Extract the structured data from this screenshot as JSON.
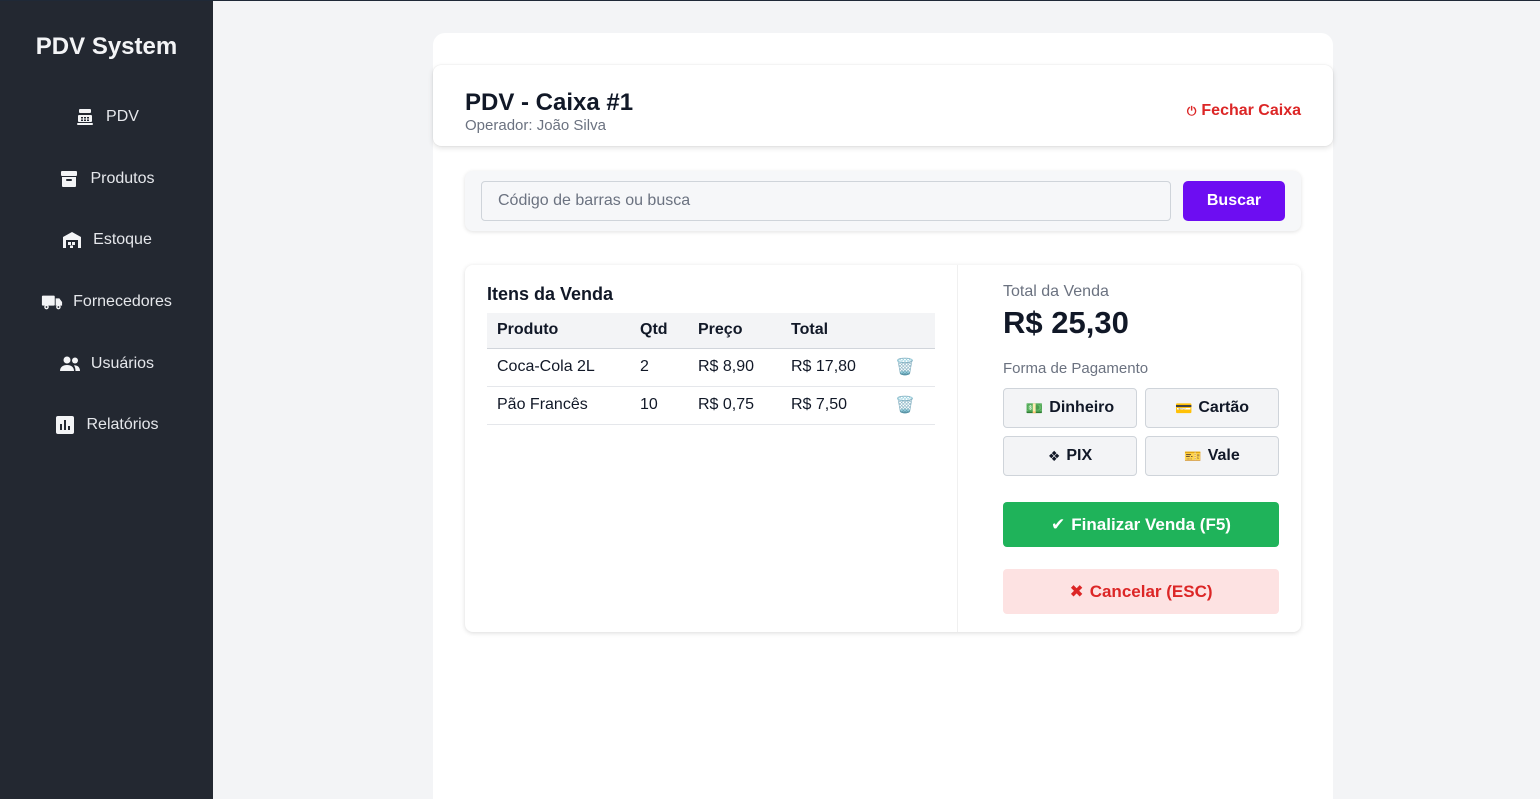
{
  "sidebar": {
    "brand": "PDV System",
    "items": [
      {
        "label": "PDV",
        "icon": "cash-register-icon"
      },
      {
        "label": "Produtos",
        "icon": "box-icon"
      },
      {
        "label": "Estoque",
        "icon": "warehouse-icon"
      },
      {
        "label": "Fornecedores",
        "icon": "truck-icon"
      },
      {
        "label": "Usuários",
        "icon": "users-icon"
      },
      {
        "label": "Relatórios",
        "icon": "chart-icon"
      }
    ]
  },
  "header": {
    "title": "PDV - Caixa #1",
    "operator": "Operador: João Silva",
    "close_icon": "⏻",
    "close_label": "Fechar Caixa"
  },
  "search": {
    "placeholder": "Código de barras ou busca",
    "value": "",
    "button_label": "Buscar"
  },
  "items": {
    "title": "Itens da Venda",
    "columns": [
      "Produto",
      "Qtd",
      "Preço",
      "Total",
      ""
    ],
    "rows": [
      {
        "product": "Coca-Cola 2L",
        "qty": "2",
        "price": "R$ 8,90",
        "total": "R$ 17,80",
        "action_icon": "🗑️"
      },
      {
        "product": "Pão Francês",
        "qty": "10",
        "price": "R$ 0,75",
        "total": "R$ 7,50",
        "action_icon": "🗑️"
      }
    ]
  },
  "payment": {
    "total_label": "Total da Venda",
    "total_value": "R$ 25,30",
    "method_label": "Forma de Pagamento",
    "methods": [
      {
        "label": "Dinheiro",
        "icon": "💵"
      },
      {
        "label": "Cartão",
        "icon": "💳"
      },
      {
        "label": "PIX",
        "icon": "❖"
      },
      {
        "label": "Vale",
        "icon": "🎫"
      }
    ],
    "finalize_mark": "✔",
    "finalize_label": "Finalizar Venda (F5)",
    "cancel_mark": "✖",
    "cancel_label": "Cancelar (ESC)"
  },
  "colors": {
    "sidebar_bg": "#232831",
    "accent_purple": "#6d0df2",
    "success_green": "#1fb35a",
    "danger_red": "#dc2626",
    "danger_bg": "#fde2e2"
  }
}
